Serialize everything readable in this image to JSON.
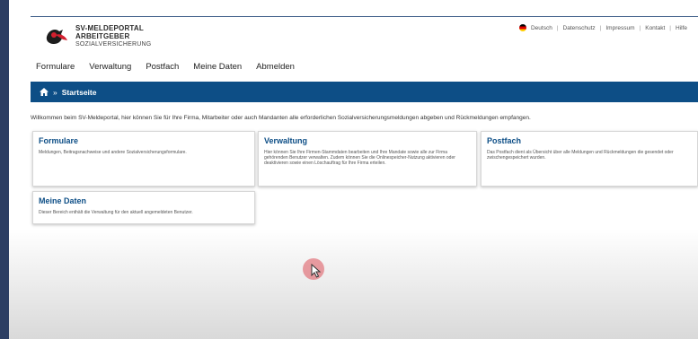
{
  "brand": {
    "line1": "SV-MELDEPORTAL",
    "line2": "ARBEITGEBER",
    "line3": "SOZIALVERSICHERUNG"
  },
  "utility_links": [
    "Deutsch",
    "Datenschutz",
    "Impressum",
    "Kontakt",
    "Hilfe"
  ],
  "nav": [
    "Formulare",
    "Verwaltung",
    "Postfach",
    "Meine Daten",
    "Abmelden"
  ],
  "breadcrumb": {
    "label": "Startseite",
    "separator": "»"
  },
  "welcome_text": "Willkommen beim SV-Meldeportal, hier können Sie für Ihre Firma, Mitarbeiter oder auch Mandanten alle erforderlichen Sozialversicherungsmeldungen abgeben und Rückmeldungen empfangen.",
  "cards": [
    {
      "title": "Formulare",
      "text": "Meldungen, Beitragsnachweise und andere Sozialversicherungsformulare."
    },
    {
      "title": "Verwaltung",
      "text": "Hier können Sie Ihre Firmen-Stammdaten bearbeiten und Ihre Mandate sowie alle zur Firma gehörenden Benutzer verwalten. Zudem können Sie die Onlinespeicher-Nutzung aktivieren oder deaktivieren sowie einen Löschauftrag für Ihre Firma erteilen."
    },
    {
      "title": "Postfach",
      "text": "Das Postfach dient als Übersicht über alle Meldungen und Rückmeldungen die gesendet oder zwischengespeichert wurden."
    },
    {
      "title": "Meine Daten",
      "text": "Dieser Bereich enthält die Verwaltung für den aktuell angemeldeten Benutzer."
    }
  ],
  "colors": {
    "primary": "#0d4e86",
    "frame": "#2c3e63"
  }
}
